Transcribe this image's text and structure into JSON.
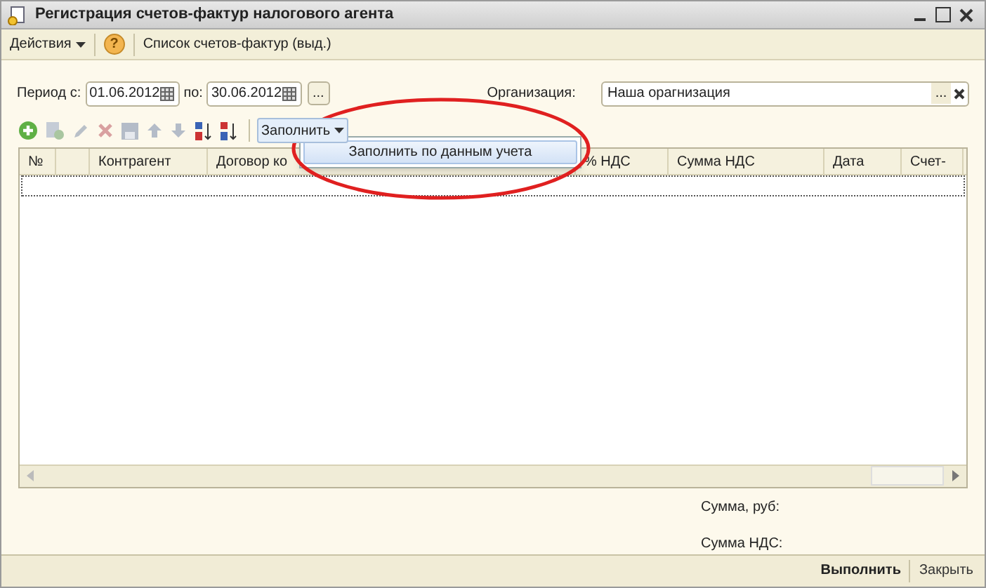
{
  "window": {
    "title": "Регистрация счетов-фактур налогового агента"
  },
  "menu": {
    "actions": "Действия",
    "help": "?",
    "link": "Список счетов-фактур (выд.)"
  },
  "period": {
    "from_label": "Период с:",
    "from": "01.06.2012",
    "to_label": "по:",
    "to": "30.06.2012",
    "more": "..."
  },
  "organization": {
    "label": "Организация:",
    "value": "Наша орагнизация",
    "more": "..."
  },
  "toolbar": {
    "fill_button": "Заполнить"
  },
  "fill_menu": {
    "items": [
      "Заполнить по данным учета"
    ]
  },
  "table": {
    "columns": [
      "№",
      "",
      "Контрагент",
      "Договор ко",
      "% НДС",
      "Сумма НДС",
      "Дата",
      "Счет-"
    ]
  },
  "totals": [
    "Сумма, руб:",
    "Сумма НДС:"
  ],
  "buttons": [
    {
      "label": "Выполнить",
      "default": true
    },
    {
      "label": "Закрыть",
      "default": false
    }
  ]
}
